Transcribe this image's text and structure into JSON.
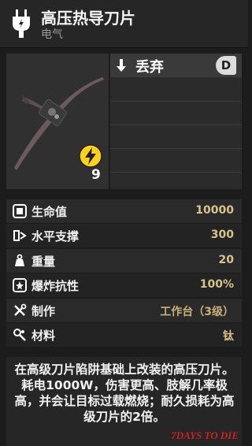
{
  "header": {
    "title": "高压热导刀片",
    "subtitle": "电气"
  },
  "preview": {
    "power_count": "9",
    "colors": {
      "bolt_bg": "#ffd21a",
      "blade": "#6b5a5e"
    }
  },
  "actions": {
    "discard_label": "丢弃",
    "discard_key": "D"
  },
  "stats": [
    {
      "icon": "heart-block-icon",
      "label": "生命值",
      "value": "10000"
    },
    {
      "icon": "horizontal-support-icon",
      "label": "水平支撑",
      "value": "300"
    },
    {
      "icon": "weight-icon",
      "label": "重量",
      "value": "20"
    },
    {
      "icon": "explosion-resist-icon",
      "label": "爆炸抗性",
      "value": "100%"
    },
    {
      "icon": "tools-icon",
      "label": "制作",
      "value": "工作台（3级）"
    },
    {
      "icon": "materials-icon",
      "label": "材料",
      "value": "钛"
    }
  ],
  "description": "在高级刀片陷阱基础上改装的高压刀片。耗电1000W，伤害更高、肢解几率极高，并会让目标过载燃烧；耐久损耗为高级刀片的2倍。",
  "watermark": "7DAYS TO DIE"
}
